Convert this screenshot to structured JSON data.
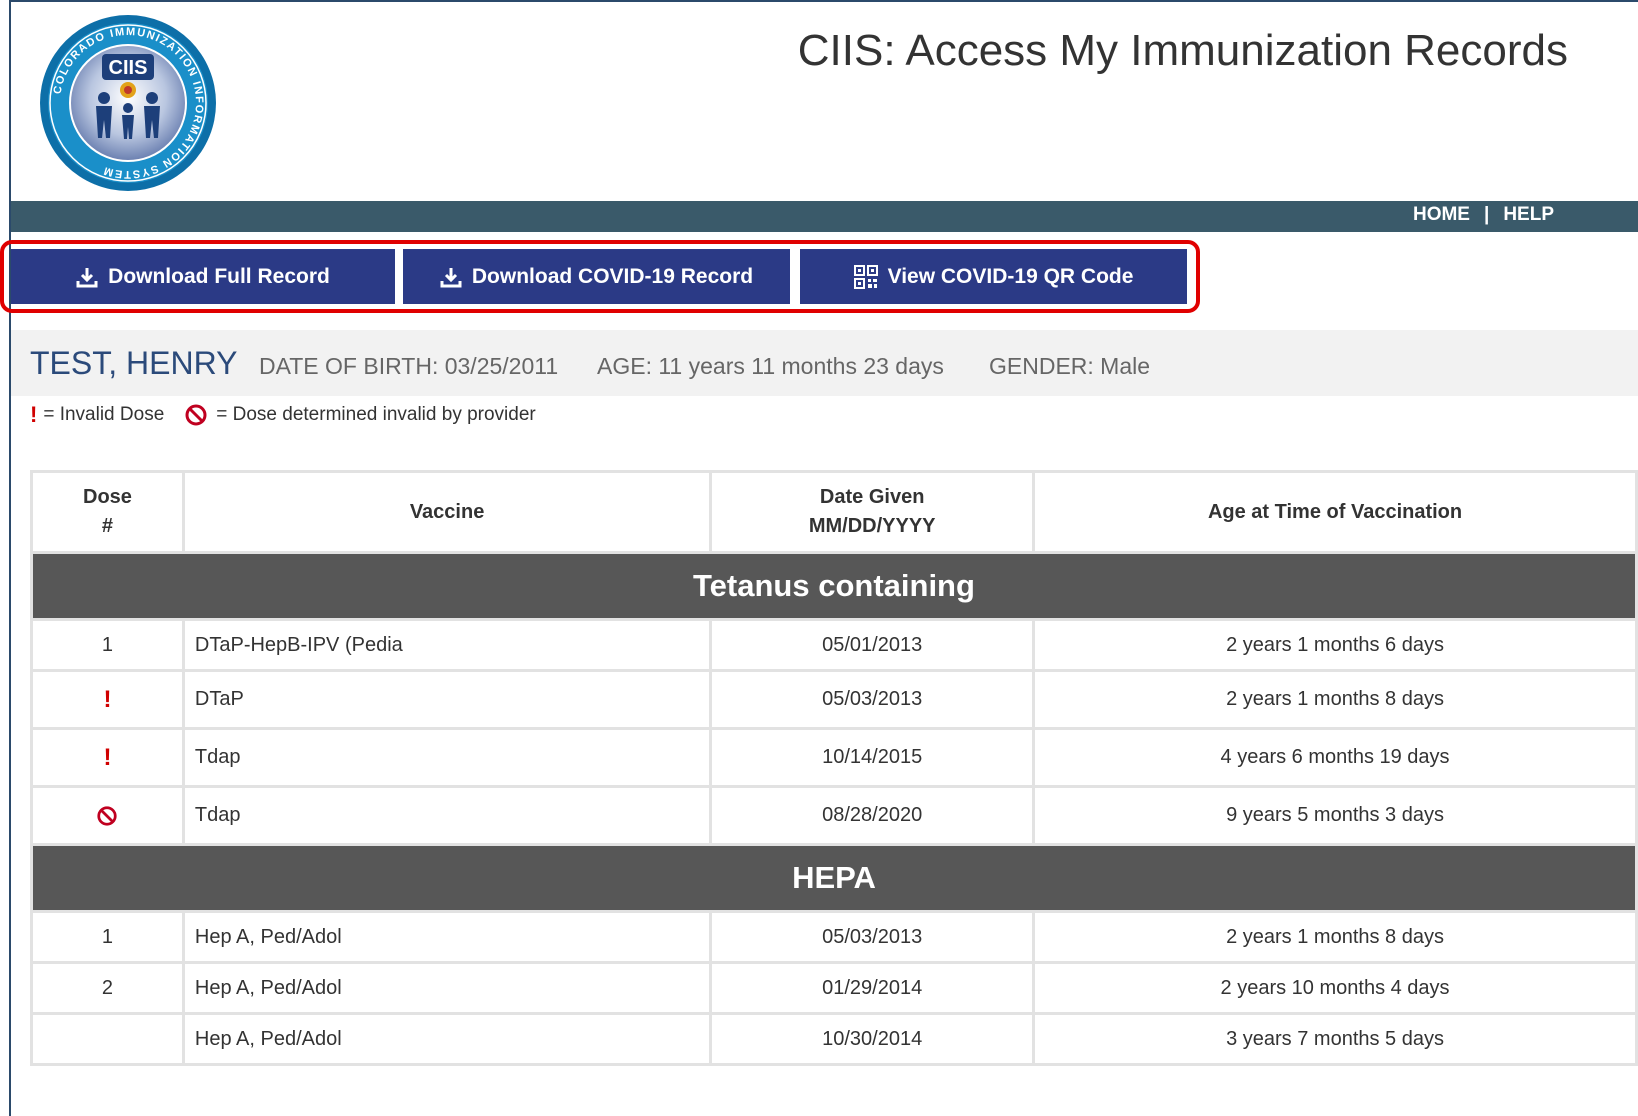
{
  "header": {
    "title": "CIIS: Access My Immunization Records",
    "logo_text": {
      "center": "CIIS",
      "ring": "COLORADO IMMUNIZATION INFORMATION SYSTEM"
    }
  },
  "nav": {
    "home": "HOME",
    "separator": "|",
    "help": "HELP"
  },
  "actions": {
    "download_full": "Download Full Record",
    "download_covid": "Download COVID-19 Record",
    "view_qr": "View COVID-19 QR Code"
  },
  "patient": {
    "name": "TEST, HENRY",
    "dob": "DATE OF BIRTH: 03/25/2011",
    "age": "AGE: 11 years 11 months 23 days",
    "gender": "GENDER: Male"
  },
  "legend": {
    "invalid_symbol": "!",
    "invalid_label": "= Invalid Dose",
    "provider_invalid_label": "= Dose determined invalid by provider"
  },
  "table": {
    "headers": {
      "dose_line1": "Dose",
      "dose_line2": "#",
      "vaccine": "Vaccine",
      "date_line1": "Date Given",
      "date_line2": "MM/DD/YYYY",
      "age": "Age at Time of Vaccination"
    },
    "groups": [
      {
        "name": "Tetanus containing",
        "rows": [
          {
            "dose": "1",
            "vaccine": "DTaP-HepB-IPV (Pedia",
            "date": "05/01/2013",
            "age": "2 years 1 months 6 days"
          },
          {
            "dose": "!",
            "vaccine": "DTaP",
            "date": "05/03/2013",
            "age": "2 years 1 months 8 days"
          },
          {
            "dose": "!",
            "vaccine": "Tdap",
            "date": "10/14/2015",
            "age": "4 years 6 months 19 days"
          },
          {
            "dose": "",
            "vaccine": "Tdap",
            "date": "08/28/2020",
            "age": "9 years 5 months 3 days"
          }
        ]
      },
      {
        "name": "HEPA",
        "rows": [
          {
            "dose": "1",
            "vaccine": "Hep A, Ped/Adol",
            "date": "05/03/2013",
            "age": "2 years 1 months 8 days"
          },
          {
            "dose": "2",
            "vaccine": "Hep A, Ped/Adol",
            "date": "01/29/2014",
            "age": "2 years 10 months 4 days"
          },
          {
            "dose": "",
            "vaccine": "Hep A, Ped/Adol",
            "date": "10/30/2014",
            "age": "3 years 7 months 5 days"
          }
        ]
      }
    ]
  },
  "colors": {
    "navbar": "#3a5a6a",
    "button": "#2b3a86",
    "highlight": "#e00000",
    "group_header": "#575757",
    "invalid": "#d00000",
    "patient_name": "#2b4a7a"
  }
}
